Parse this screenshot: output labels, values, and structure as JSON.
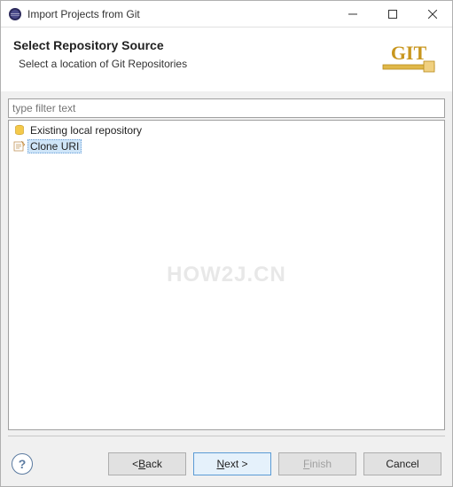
{
  "window": {
    "title": "Import Projects from Git"
  },
  "header": {
    "title": "Select Repository Source",
    "subtitle": "Select a location of Git Repositories",
    "logo_text": "GIT"
  },
  "filter": {
    "placeholder": "type filter text"
  },
  "list": {
    "items": [
      {
        "label": "Existing local repository",
        "selected": false
      },
      {
        "label": "Clone URI",
        "selected": true
      }
    ]
  },
  "watermark": "HOW2J.CN",
  "buttons": {
    "help": "?",
    "back_prefix": "< ",
    "back_mnemonic": "B",
    "back_rest": "ack",
    "next_mnemonic": "N",
    "next_rest": "ext >",
    "finish_mnemonic": "F",
    "finish_rest": "inish",
    "cancel": "Cancel"
  }
}
